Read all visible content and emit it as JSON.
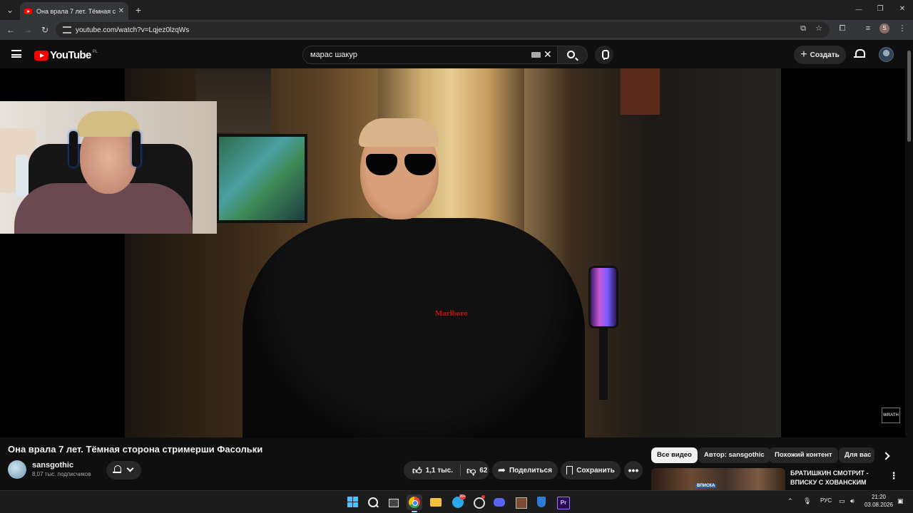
{
  "browser": {
    "tab_title": "Она врала 7 лет. Тёмная сторона стримерши Фасольки",
    "tab_close": "✕",
    "new_tab": "+",
    "url": "youtube.com/watch?v=Lqjez0lzqWs",
    "profile_initial": "S",
    "window_controls": [
      "—",
      "❐",
      "✕"
    ]
  },
  "youtube": {
    "logo_text": "YouTube",
    "country_code": "PL",
    "search_value": "марас шакур",
    "create_label": "Создать",
    "create_plus": "+"
  },
  "video": {
    "title": "Она врала 7 лет. Тёмная сторона стримерши Фасольки",
    "channel_name": "sansgothic",
    "subscribers": "8,07 тыс. подписчиков",
    "likes": "1,1 тыс.",
    "dislikes": "62",
    "share_label": "Поделиться",
    "save_label": "Сохранить",
    "more_label": "•••",
    "shirt_logo": "Marlboro",
    "watermark": "WRATH"
  },
  "chips": [
    "Все видео",
    "Автор: sansgothic",
    "Похожий контент",
    "Для вас"
  ],
  "recommended": {
    "title": "БРАТИШКИН СМОТРИТ - ВПИСКУ С ХОВАНСКИМ",
    "thumb_tag": "ВПИСКА",
    "more": "⋮"
  },
  "taskbar": {
    "telegram_badge": "99+",
    "language": "РУС",
    "time": "21:20",
    "date": "03.08.2026"
  },
  "icons": [
    "tab-search-icon",
    "youtube-favicon",
    "back-icon",
    "forward-icon",
    "reload-icon",
    "site-info-icon",
    "cast-icon",
    "star-icon",
    "extensions-icon",
    "media-icon",
    "kebab-menu-icon",
    "hamburger-icon",
    "keyboard-icon",
    "clear-icon",
    "search-icon",
    "mic-icon",
    "bell-icon",
    "like-icon",
    "dislike-icon",
    "share-icon",
    "bookmark-icon",
    "chevron-right-icon"
  ],
  "colors": {
    "youtube_red": "#ff0000",
    "background": "#0f0f0f",
    "pill": "#272727",
    "chip_active": "#f1f1f1"
  }
}
